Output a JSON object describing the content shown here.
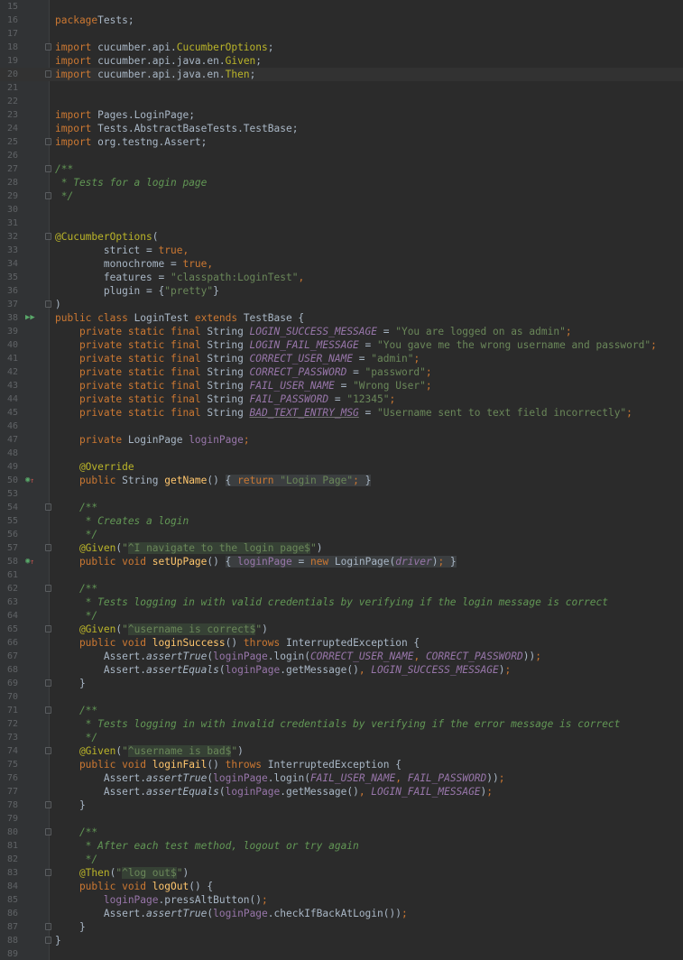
{
  "editor": {
    "language": "java",
    "colors": {
      "background": "#2b2b2b",
      "gutter": "#313335",
      "line_number": "#606366",
      "keyword": "#cc7832",
      "string": "#6a8759",
      "annotation": "#bbb529",
      "comment": "#629755",
      "constant": "#9876aa",
      "method": "#ffc66d",
      "text": "#a9b7c6"
    },
    "current_line": "20",
    "lines": [
      {
        "n": "15",
        "tokens": []
      },
      {
        "n": "16",
        "tokens": [
          [
            "kw",
            "package"
          ],
          [
            "",
            "Tests;"
          ]
        ]
      },
      {
        "n": "17",
        "tokens": []
      },
      {
        "n": "18",
        "fold": true,
        "tokens": [
          [
            "kw",
            "import"
          ],
          [
            "",
            " cucumber.api."
          ],
          [
            "ann",
            "CucumberOptions"
          ],
          [
            "",
            ";"
          ]
        ]
      },
      {
        "n": "19",
        "tokens": [
          [
            "kw",
            "import"
          ],
          [
            "",
            " cucumber.api.java.en."
          ],
          [
            "ann",
            "Given"
          ],
          [
            "",
            ";"
          ]
        ]
      },
      {
        "n": "20",
        "fold": true,
        "tokens": [
          [
            "kw",
            "import"
          ],
          [
            "",
            " cucumber.api.java.en."
          ],
          [
            "ann",
            "Then"
          ],
          [
            "",
            ";"
          ]
        ]
      },
      {
        "n": "21",
        "tokens": []
      },
      {
        "n": "22",
        "tokens": []
      },
      {
        "n": "23",
        "tokens": [
          [
            "kw",
            "import"
          ],
          [
            "",
            " Pages.LoginPage;"
          ]
        ]
      },
      {
        "n": "24",
        "tokens": [
          [
            "kw",
            "import"
          ],
          [
            "",
            " Tests.AbstractBaseTests.TestBase;"
          ]
        ]
      },
      {
        "n": "25",
        "fold": true,
        "tokens": [
          [
            "kw",
            "import"
          ],
          [
            "",
            " org.testng.Assert;"
          ]
        ]
      },
      {
        "n": "26",
        "tokens": []
      },
      {
        "n": "27",
        "fold": true,
        "tokens": [
          [
            "cmt",
            "/**"
          ]
        ]
      },
      {
        "n": "28",
        "tokens": [
          [
            "cmt",
            " * Tests for a login page"
          ]
        ]
      },
      {
        "n": "29",
        "fold": true,
        "tokens": [
          [
            "cmt",
            " */"
          ]
        ]
      },
      {
        "n": "30",
        "tokens": []
      },
      {
        "n": "31",
        "tokens": []
      },
      {
        "n": "32",
        "fold": true,
        "tokens": [
          [
            "ann",
            "@CucumberOptions"
          ],
          [
            "",
            "("
          ]
        ]
      },
      {
        "n": "33",
        "tokens": [
          [
            "",
            "        strict = "
          ],
          [
            "kw",
            "true,"
          ]
        ]
      },
      {
        "n": "34",
        "tokens": [
          [
            "",
            "        monochrome = "
          ],
          [
            "kw",
            "true,"
          ]
        ]
      },
      {
        "n": "35",
        "tokens": [
          [
            "",
            "        features = "
          ],
          [
            "str",
            "\"classpath:LoginTest\""
          ],
          [
            "kw",
            ","
          ]
        ]
      },
      {
        "n": "36",
        "tokens": [
          [
            "",
            "        plugin = {"
          ],
          [
            "str",
            "\"pretty\""
          ],
          [
            "",
            "}"
          ]
        ]
      },
      {
        "n": "37",
        "fold": true,
        "tokens": [
          [
            "",
            ")"
          ]
        ]
      },
      {
        "n": "38",
        "marker": "run",
        "tokens": [
          [
            "kw",
            "public class "
          ],
          [
            "",
            "LoginTest "
          ],
          [
            "kw",
            "extends "
          ],
          [
            "",
            "TestBase {"
          ]
        ]
      },
      {
        "n": "39",
        "tokens": [
          [
            "kw",
            "    private static final "
          ],
          [
            "",
            "String "
          ],
          [
            "cst",
            "LOGIN_SUCCESS_MESSAGE"
          ],
          [
            "",
            " = "
          ],
          [
            "str",
            "\"You are logged on as admin\""
          ],
          [
            "kw",
            ";"
          ]
        ]
      },
      {
        "n": "40",
        "tokens": [
          [
            "kw",
            "    private static final "
          ],
          [
            "",
            "String "
          ],
          [
            "cst",
            "LOGIN_FAIL_MESSAGE"
          ],
          [
            "",
            " = "
          ],
          [
            "str",
            "\"You gave me the wrong username and password\""
          ],
          [
            "kw",
            ";"
          ]
        ]
      },
      {
        "n": "41",
        "tokens": [
          [
            "kw",
            "    private static final "
          ],
          [
            "",
            "String "
          ],
          [
            "cst",
            "CORRECT_USER_NAME"
          ],
          [
            "",
            " = "
          ],
          [
            "str",
            "\"admin\""
          ],
          [
            "kw",
            ";"
          ]
        ]
      },
      {
        "n": "42",
        "tokens": [
          [
            "kw",
            "    private static final "
          ],
          [
            "",
            "String "
          ],
          [
            "cst",
            "CORRECT_PASSWORD"
          ],
          [
            "",
            " = "
          ],
          [
            "str",
            "\"password\""
          ],
          [
            "kw",
            ";"
          ]
        ]
      },
      {
        "n": "43",
        "tokens": [
          [
            "kw",
            "    private static final "
          ],
          [
            "",
            "String "
          ],
          [
            "cst",
            "FAIL_USER_NAME"
          ],
          [
            "",
            " = "
          ],
          [
            "str",
            "\"Wrong User\""
          ],
          [
            "kw",
            ";"
          ]
        ]
      },
      {
        "n": "44",
        "tokens": [
          [
            "kw",
            "    private static final "
          ],
          [
            "",
            "String "
          ],
          [
            "cst",
            "FAIL_PASSWORD"
          ],
          [
            "",
            " = "
          ],
          [
            "str",
            "\"12345\""
          ],
          [
            "kw",
            ";"
          ]
        ]
      },
      {
        "n": "45",
        "tokens": [
          [
            "kw",
            "    private static final "
          ],
          [
            "",
            "String "
          ],
          [
            "cst under",
            "BAD_TEXT_ENTRY_MSG"
          ],
          [
            "",
            " = "
          ],
          [
            "str",
            "\"Username sent to text field incorrectly\""
          ],
          [
            "kw",
            ";"
          ]
        ]
      },
      {
        "n": "46",
        "tokens": []
      },
      {
        "n": "47",
        "tokens": [
          [
            "kw",
            "    private "
          ],
          [
            "",
            "LoginPage "
          ],
          [
            "fld",
            "loginPage"
          ],
          [
            "kw",
            ";"
          ]
        ]
      },
      {
        "n": "48",
        "tokens": []
      },
      {
        "n": "49",
        "tokens": [
          [
            "ann",
            "    @Override"
          ]
        ]
      },
      {
        "n": "50",
        "marker": "override",
        "tokens": [
          [
            "kw",
            "    public "
          ],
          [
            "",
            "String "
          ],
          [
            "mth",
            "getName"
          ],
          [
            "",
            "() "
          ],
          [
            "fb",
            "{ "
          ],
          [
            "kw fb",
            "return "
          ],
          [
            "str fb",
            "\"Login Page\""
          ],
          [
            "kw fb",
            ";"
          ],
          [
            "fb",
            " }"
          ]
        ]
      },
      {
        "n": "53",
        "tokens": []
      },
      {
        "n": "54",
        "fold": true,
        "tokens": [
          [
            "cmt",
            "    /**"
          ]
        ]
      },
      {
        "n": "55",
        "tokens": [
          [
            "cmt",
            "     * Creates a login"
          ]
        ]
      },
      {
        "n": "56",
        "tokens": [
          [
            "cmt",
            "     */"
          ]
        ]
      },
      {
        "n": "57",
        "fold": true,
        "tokens": [
          [
            "ann",
            "    @Given"
          ],
          [
            "",
            "("
          ],
          [
            "str",
            "\""
          ],
          [
            "str reg",
            "^I navigate to the login page$"
          ],
          [
            "str",
            "\""
          ],
          [
            "",
            ")"
          ]
        ]
      },
      {
        "n": "58",
        "marker": "override",
        "tokens": [
          [
            "kw",
            "    public void "
          ],
          [
            "mth",
            "setUpPage"
          ],
          [
            "",
            "() "
          ],
          [
            "fb",
            "{ "
          ],
          [
            "fld fb",
            "loginPage"
          ],
          [
            "fb",
            " = "
          ],
          [
            "kw fb",
            "new "
          ],
          [
            "fb",
            "LoginPage("
          ],
          [
            "cst fb",
            "driver"
          ],
          [
            "fb",
            ")"
          ],
          [
            "kw fb",
            ";"
          ],
          [
            "fb",
            " }"
          ]
        ]
      },
      {
        "n": "61",
        "tokens": []
      },
      {
        "n": "62",
        "fold": true,
        "tokens": [
          [
            "cmt",
            "    /**"
          ]
        ]
      },
      {
        "n": "63",
        "tokens": [
          [
            "cmt",
            "     * Tests logging in with valid credentials by verifying if the login message is correct"
          ]
        ]
      },
      {
        "n": "64",
        "tokens": [
          [
            "cmt",
            "     */"
          ]
        ]
      },
      {
        "n": "65",
        "fold": true,
        "tokens": [
          [
            "ann",
            "    @Given"
          ],
          [
            "",
            "("
          ],
          [
            "str",
            "\""
          ],
          [
            "str reg",
            "^username is correct$"
          ],
          [
            "str",
            "\""
          ],
          [
            "",
            ")"
          ]
        ]
      },
      {
        "n": "66",
        "tokens": [
          [
            "kw",
            "    public void "
          ],
          [
            "mth",
            "loginSuccess"
          ],
          [
            "",
            "() "
          ],
          [
            "kw",
            "throws "
          ],
          [
            "",
            "InterruptedException {"
          ]
        ]
      },
      {
        "n": "67",
        "tokens": [
          [
            "",
            "        Assert."
          ],
          [
            "sm",
            "assertTrue"
          ],
          [
            "",
            "("
          ],
          [
            "fld",
            "loginPage"
          ],
          [
            "",
            ".login("
          ],
          [
            "cst",
            "CORRECT_USER_NAME"
          ],
          [
            "kw",
            ", "
          ],
          [
            "cst",
            "CORRECT_PASSWORD"
          ],
          [
            "",
            "))"
          ],
          [
            "kw",
            ";"
          ]
        ]
      },
      {
        "n": "68",
        "tokens": [
          [
            "",
            "        Assert."
          ],
          [
            "sm",
            "assertEquals"
          ],
          [
            "",
            "("
          ],
          [
            "fld",
            "loginPage"
          ],
          [
            "",
            ".getMessage()"
          ],
          [
            "kw",
            ", "
          ],
          [
            "cst",
            "LOGIN_SUCCESS_MESSAGE"
          ],
          [
            "",
            ")"
          ],
          [
            "kw",
            ";"
          ]
        ]
      },
      {
        "n": "69",
        "fold": true,
        "tokens": [
          [
            "",
            "    }"
          ]
        ]
      },
      {
        "n": "70",
        "tokens": []
      },
      {
        "n": "71",
        "fold": true,
        "tokens": [
          [
            "cmt",
            "    /**"
          ]
        ]
      },
      {
        "n": "72",
        "tokens": [
          [
            "cmt",
            "     * Tests logging in with invalid credentials by verifying if the error message is correct"
          ]
        ]
      },
      {
        "n": "73",
        "tokens": [
          [
            "cmt",
            "     */"
          ]
        ]
      },
      {
        "n": "74",
        "fold": true,
        "tokens": [
          [
            "ann",
            "    @Given"
          ],
          [
            "",
            "("
          ],
          [
            "str",
            "\""
          ],
          [
            "str reg",
            "^username is bad$"
          ],
          [
            "str",
            "\""
          ],
          [
            "",
            ")"
          ]
        ]
      },
      {
        "n": "75",
        "tokens": [
          [
            "kw",
            "    public void "
          ],
          [
            "mth",
            "loginFail"
          ],
          [
            "",
            "() "
          ],
          [
            "kw",
            "throws "
          ],
          [
            "",
            "InterruptedException {"
          ]
        ]
      },
      {
        "n": "76",
        "tokens": [
          [
            "",
            "        Assert."
          ],
          [
            "sm",
            "assertTrue"
          ],
          [
            "",
            "("
          ],
          [
            "fld",
            "loginPage"
          ],
          [
            "",
            ".login("
          ],
          [
            "cst",
            "FAIL_USER_NAME"
          ],
          [
            "kw",
            ", "
          ],
          [
            "cst",
            "FAIL_PASSWORD"
          ],
          [
            "",
            "))"
          ],
          [
            "kw",
            ";"
          ]
        ]
      },
      {
        "n": "77",
        "tokens": [
          [
            "",
            "        Assert."
          ],
          [
            "sm",
            "assertEquals"
          ],
          [
            "",
            "("
          ],
          [
            "fld",
            "loginPage"
          ],
          [
            "",
            ".getMessage()"
          ],
          [
            "kw",
            ", "
          ],
          [
            "cst",
            "LOGIN_FAIL_MESSAGE"
          ],
          [
            "",
            ")"
          ],
          [
            "kw",
            ";"
          ]
        ]
      },
      {
        "n": "78",
        "fold": true,
        "tokens": [
          [
            "",
            "    }"
          ]
        ]
      },
      {
        "n": "79",
        "tokens": []
      },
      {
        "n": "80",
        "fold": true,
        "tokens": [
          [
            "cmt",
            "    /**"
          ]
        ]
      },
      {
        "n": "81",
        "tokens": [
          [
            "cmt",
            "     * After each test method, logout or try again"
          ]
        ]
      },
      {
        "n": "82",
        "tokens": [
          [
            "cmt",
            "     */"
          ]
        ]
      },
      {
        "n": "83",
        "fold": true,
        "tokens": [
          [
            "ann",
            "    @Then"
          ],
          [
            "",
            "("
          ],
          [
            "str",
            "\""
          ],
          [
            "str reg",
            "^log out$"
          ],
          [
            "str",
            "\""
          ],
          [
            "",
            ")"
          ]
        ]
      },
      {
        "n": "84",
        "tokens": [
          [
            "kw",
            "    public void "
          ],
          [
            "mth",
            "logOut"
          ],
          [
            "",
            "() {"
          ]
        ]
      },
      {
        "n": "85",
        "tokens": [
          [
            "fld",
            "        loginPage"
          ],
          [
            "",
            ".pressAltButton()"
          ],
          [
            "kw",
            ";"
          ]
        ]
      },
      {
        "n": "86",
        "tokens": [
          [
            "",
            "        Assert."
          ],
          [
            "sm",
            "assertTrue"
          ],
          [
            "",
            "("
          ],
          [
            "fld",
            "loginPage"
          ],
          [
            "",
            ".checkIfBackAtLogin())"
          ],
          [
            "kw",
            ";"
          ]
        ]
      },
      {
        "n": "87",
        "fold": true,
        "tokens": [
          [
            "",
            "    }"
          ]
        ]
      },
      {
        "n": "88",
        "fold": true,
        "tokens": [
          [
            "",
            "}"
          ]
        ]
      },
      {
        "n": "89",
        "tokens": []
      }
    ]
  }
}
